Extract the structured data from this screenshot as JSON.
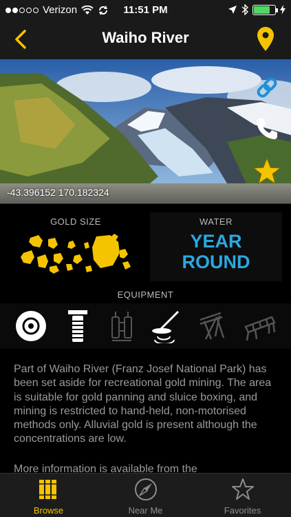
{
  "status_bar": {
    "carrier": "Verizon",
    "time": "11:51 PM",
    "battery_level": 0.75,
    "battery_color": "#4cd964",
    "signal_bars": 2,
    "icons": [
      "wifi-icon",
      "sync-icon",
      "location-arrow-icon",
      "bluetooth-icon",
      "battery-icon",
      "charging-icon"
    ]
  },
  "nav": {
    "title": "Waiho River",
    "back_icon": "chevron-left-icon",
    "map_icon": "map-pin-icon",
    "accent_color": "#f5c400"
  },
  "hero": {
    "coordinates": "-43.396152   170.182324",
    "actions": [
      "link-icon",
      "phone-icon",
      "star-icon"
    ],
    "link_color": "#1e90d8",
    "star_color": "#f5c400"
  },
  "gold_size": {
    "label": "GOLD SIZE",
    "icon": "gold-flakes-icon",
    "color": "#f5c400"
  },
  "water": {
    "label": "WATER",
    "value_line1": "YEAR",
    "value_line2": "ROUND",
    "color": "#2aa8e0"
  },
  "equipment": {
    "label": "EQUIPMENT",
    "items": [
      {
        "icon": "gold-pan-icon",
        "active": true
      },
      {
        "icon": "shovel-icon",
        "active": true
      },
      {
        "icon": "dredge-icon",
        "active": false
      },
      {
        "icon": "metal-detector-icon",
        "active": true
      },
      {
        "icon": "highbanker-icon",
        "active": false
      },
      {
        "icon": "sluice-box-icon",
        "active": false
      }
    ]
  },
  "description": "Part of Waiho River (Franz Josef National Park) has been set aside for recreational gold mining. The area is suitable for gold panning and sluice boxing, and mining is restricted to hand-held, non-motorised methods only. Alluvial gold is present although the concentrations are low.",
  "more_info": "More information is available from the",
  "tabs": [
    {
      "label": "Browse",
      "icon": "browse-books-icon",
      "active": true
    },
    {
      "label": "Near Me",
      "icon": "compass-icon",
      "active": false
    },
    {
      "label": "Favorites",
      "icon": "favorites-star-icon",
      "active": false
    }
  ]
}
